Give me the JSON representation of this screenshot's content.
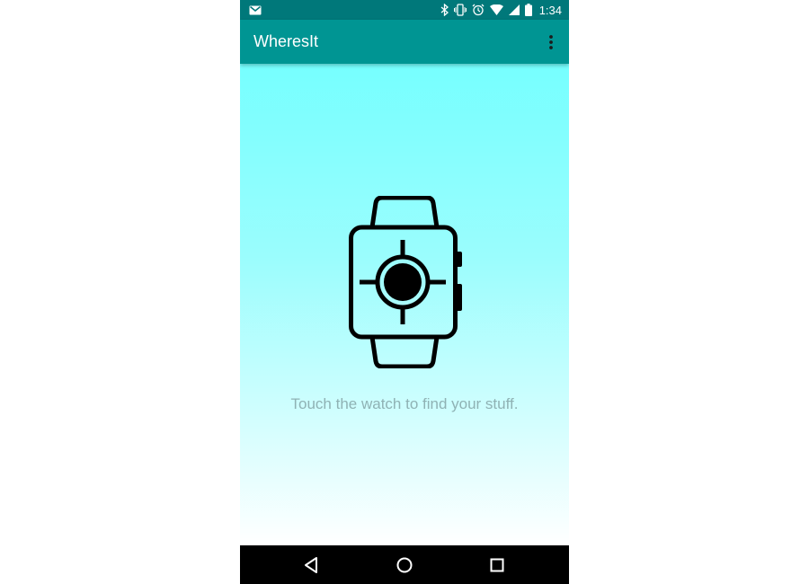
{
  "status_bar": {
    "time": "1:34",
    "icons": [
      "gmail-icon",
      "bluetooth-icon",
      "vibrate-icon",
      "alarm-icon",
      "wifi-icon",
      "signal-icon",
      "battery-icon"
    ]
  },
  "app_bar": {
    "title": "WheresIt",
    "overflow_icon": "more-vert-icon"
  },
  "main": {
    "watch_icon": "smartwatch-locate-icon",
    "hint": "Touch the watch to find your stuff."
  },
  "nav_bar": {
    "icons": [
      "back-icon",
      "home-icon",
      "recents-icon"
    ]
  },
  "colors": {
    "status_bar": "#00787a",
    "app_bar": "#009593",
    "gradient_top": "#76ffff",
    "gradient_bottom": "#ffffff",
    "hint_text": "#8fb2b4"
  }
}
